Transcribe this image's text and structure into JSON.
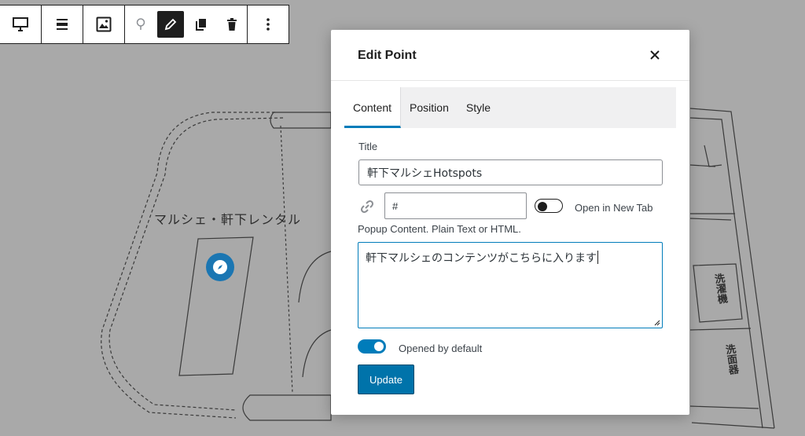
{
  "background": {
    "plan_label": "マルシェ・軒下レンタル",
    "kanji_label_1": "洗濯機",
    "kanji_label_2": "洗面器",
    "marker_icon": "compass-icon"
  },
  "toolbar": {
    "groups": [
      {
        "icons": [
          "hotspot-block-icon"
        ]
      },
      {
        "icons": [
          "align-icon"
        ]
      },
      {
        "icons": [
          "replace-image-icon"
        ]
      },
      {
        "icons": [
          "pin-icon",
          "edit-pencil-icon",
          "duplicate-icon",
          "trash-icon"
        ],
        "active": "edit-pencil-icon"
      },
      {
        "icons": [
          "more-options-icon"
        ]
      }
    ]
  },
  "modal": {
    "title": "Edit Point",
    "close_icon": "close-icon",
    "tabs": [
      {
        "label": "Content",
        "active": true
      },
      {
        "label": "Position",
        "active": false
      },
      {
        "label": "Style",
        "active": false
      }
    ],
    "title_field": {
      "label": "Title",
      "value": "軒下マルシェHotspots"
    },
    "link": {
      "icon": "link-icon",
      "value": "#",
      "new_tab_label": "Open in New Tab",
      "new_tab_enabled": false
    },
    "popup": {
      "label": "Popup Content. Plain Text or HTML.",
      "value": "軒下マルシェのコンテンツがこちらに入ります"
    },
    "opened_by_default": {
      "label": "Opened by default",
      "enabled": true
    },
    "update_label": "Update"
  },
  "colors": {
    "accent": "#007cba",
    "button": "#0073aa",
    "overlay": "#a9a9a9"
  }
}
